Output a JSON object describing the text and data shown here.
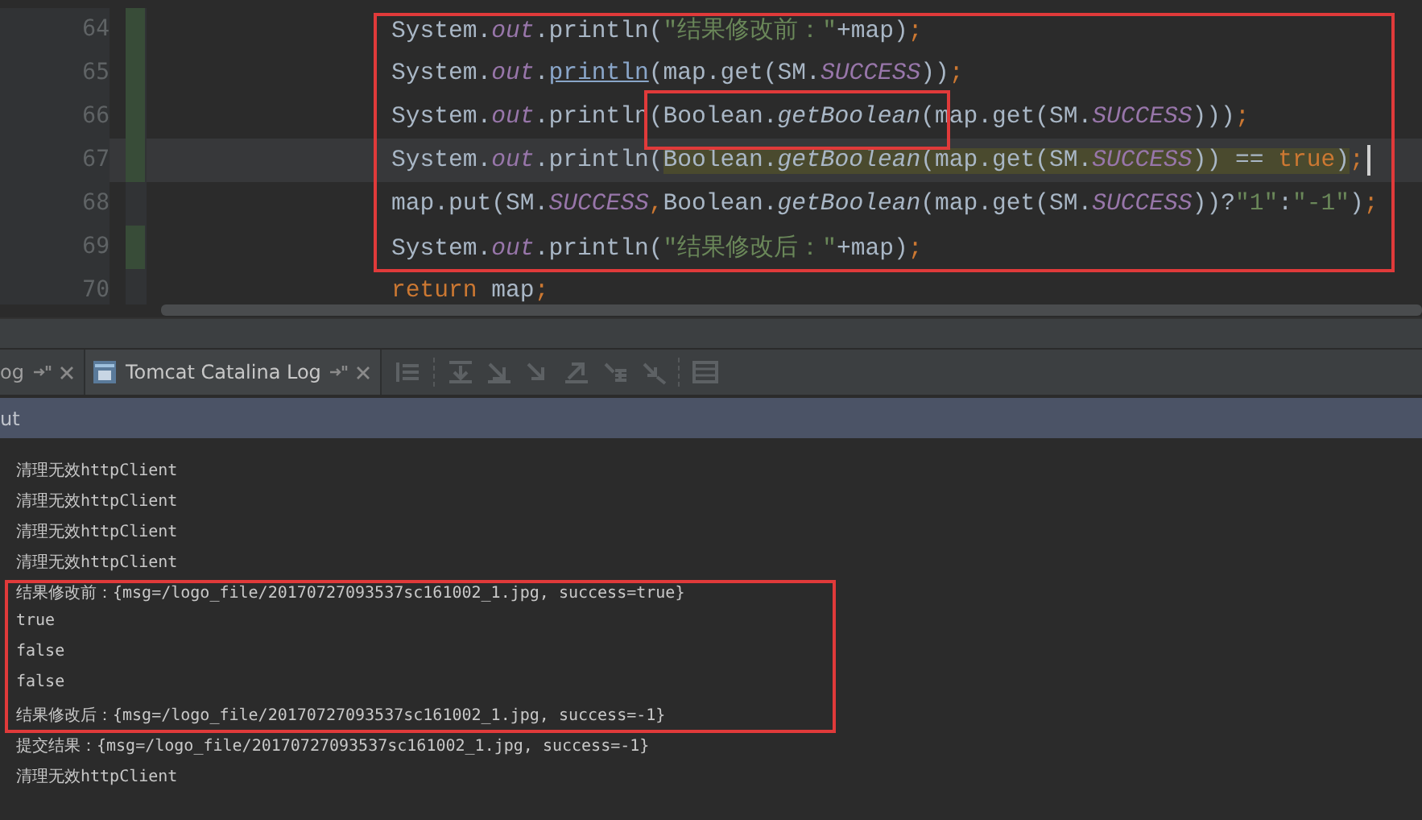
{
  "editor": {
    "lines": [
      {
        "number": "64",
        "changed": true,
        "current": false,
        "tokens": [
          {
            "kind": "plain",
            "text": "System."
          },
          {
            "kind": "field",
            "text": "out"
          },
          {
            "kind": "plain",
            "text": ".println("
          },
          {
            "kind": "string",
            "text": "\"结果修改前：\""
          },
          {
            "kind": "plain",
            "text": "+map)"
          },
          {
            "kind": "keyword",
            "text": ";"
          }
        ]
      },
      {
        "number": "65",
        "changed": true,
        "current": false,
        "tokens": [
          {
            "kind": "plain",
            "text": "System."
          },
          {
            "kind": "field",
            "text": "out"
          },
          {
            "kind": "plain",
            "text": "."
          },
          {
            "kind": "link",
            "text": "println"
          },
          {
            "kind": "plain",
            "text": "(map.get(SM."
          },
          {
            "kind": "field",
            "text": "SUCCESS"
          },
          {
            "kind": "plain",
            "text": "))"
          },
          {
            "kind": "keyword",
            "text": ";"
          }
        ]
      },
      {
        "number": "66",
        "changed": true,
        "current": false,
        "tokens": [
          {
            "kind": "plain",
            "text": "System."
          },
          {
            "kind": "field",
            "text": "out"
          },
          {
            "kind": "plain",
            "text": ".println(Boolean."
          },
          {
            "kind": "method",
            "text": "getBoolean"
          },
          {
            "kind": "plain",
            "text": "(map.get(SM."
          },
          {
            "kind": "field",
            "text": "SUCCESS"
          },
          {
            "kind": "plain",
            "text": ")))"
          },
          {
            "kind": "keyword",
            "text": ";"
          }
        ]
      },
      {
        "number": "67",
        "changed": true,
        "current": true,
        "tokens": [
          {
            "kind": "plain",
            "text": "System."
          },
          {
            "kind": "field",
            "text": "out"
          },
          {
            "kind": "plain",
            "text": ".println("
          },
          {
            "kind": "match",
            "text": "Boolean."
          },
          {
            "kind": "match-method",
            "text": "getBoolean"
          },
          {
            "kind": "match",
            "text": "(map.get(SM."
          },
          {
            "kind": "match-field",
            "text": "SUCCESS"
          },
          {
            "kind": "match",
            "text": ")) == "
          },
          {
            "kind": "match-keyword",
            "text": "true"
          },
          {
            "kind": "match",
            "text": ")"
          },
          {
            "kind": "keyword",
            "text": ";"
          }
        ]
      },
      {
        "number": "68",
        "changed": false,
        "current": false,
        "tokens": [
          {
            "kind": "plain",
            "text": "map.put(SM."
          },
          {
            "kind": "field",
            "text": "SUCCESS"
          },
          {
            "kind": "keyword",
            "text": ","
          },
          {
            "kind": "plain",
            "text": "Boolean."
          },
          {
            "kind": "method",
            "text": "getBoolean"
          },
          {
            "kind": "plain",
            "text": "(map.get(SM."
          },
          {
            "kind": "field",
            "text": "SUCCESS"
          },
          {
            "kind": "plain",
            "text": "))?"
          },
          {
            "kind": "string",
            "text": "\"1\""
          },
          {
            "kind": "plain",
            "text": ":"
          },
          {
            "kind": "string",
            "text": "\"-1\""
          },
          {
            "kind": "plain",
            "text": ")"
          },
          {
            "kind": "keyword",
            "text": ";"
          }
        ]
      },
      {
        "number": "69",
        "changed": true,
        "current": false,
        "tokens": [
          {
            "kind": "plain",
            "text": "System."
          },
          {
            "kind": "field",
            "text": "out"
          },
          {
            "kind": "plain",
            "text": ".println("
          },
          {
            "kind": "string",
            "text": "\"结果修改后：\""
          },
          {
            "kind": "plain",
            "text": "+map)"
          },
          {
            "kind": "keyword",
            "text": ";"
          }
        ]
      },
      {
        "number": "70",
        "changed": false,
        "current": false,
        "tokens": [
          {
            "kind": "keyword",
            "text": "return "
          },
          {
            "kind": "plain",
            "text": "map"
          },
          {
            "kind": "keyword",
            "text": ";"
          }
        ]
      }
    ]
  },
  "tabs": [
    {
      "label": "og",
      "selected": false
    },
    {
      "label": "Tomcat Catalina Log",
      "selected": true
    }
  ],
  "console": {
    "header": "ut",
    "lines": [
      "清理无效httpClient",
      "清理无效httpClient",
      "清理无效httpClient",
      "清理无效httpClient",
      "结果修改前：{msg=/logo_file/20170727093537sc161002_1.jpg, success=true}",
      "true",
      "false",
      "false",
      "结果修改后：{msg=/logo_file/20170727093537sc161002_1.jpg, success=-1}",
      "提交结果：{msg=/logo_file/20170727093537sc161002_1.jpg, success=-1}",
      "清理无效httpClient"
    ]
  }
}
